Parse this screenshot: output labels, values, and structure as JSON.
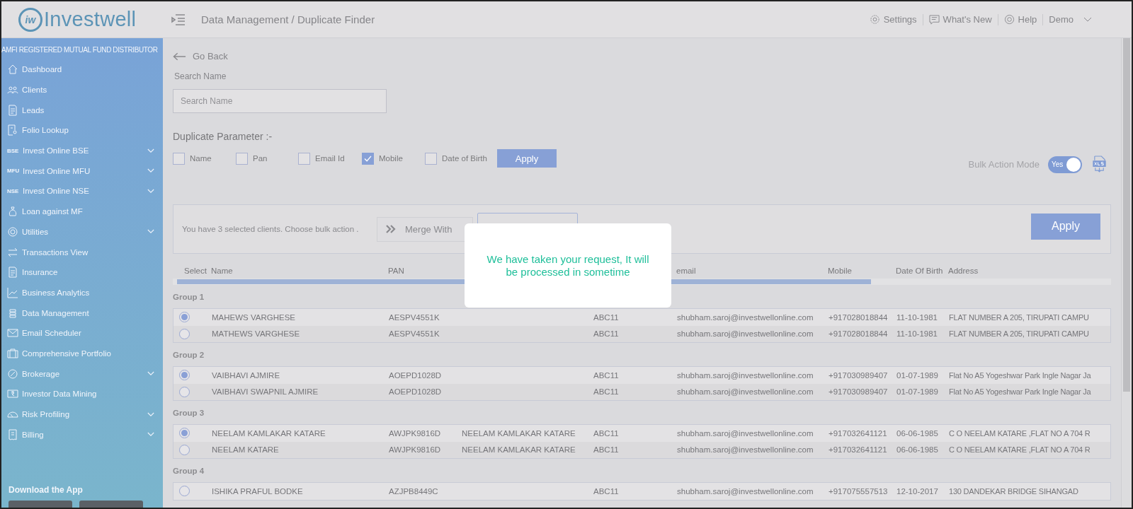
{
  "header": {
    "logo_mark": "iw",
    "logo": "Investwell",
    "breadcrumb": "Data Management / Duplicate Finder",
    "links": [
      {
        "label": "Settings"
      },
      {
        "label": "What's New"
      },
      {
        "label": "Help"
      }
    ],
    "user": "Demo"
  },
  "sidebar": {
    "tagline": "AMFI REGISTERED MUTUAL FUND DISTRIBUTOR",
    "items": [
      {
        "label": "Dashboard",
        "has_submenu": false
      },
      {
        "label": "Clients",
        "has_submenu": false
      },
      {
        "label": "Leads",
        "has_submenu": false
      },
      {
        "label": "Folio Lookup",
        "has_submenu": false
      },
      {
        "label": "Invest Online BSE",
        "prefix": "BSE",
        "has_submenu": true
      },
      {
        "label": "Invest Online MFU",
        "prefix": "MFU",
        "has_submenu": true
      },
      {
        "label": "Invest Online NSE",
        "prefix": "NSE",
        "has_submenu": true
      },
      {
        "label": "Loan against MF",
        "has_submenu": false
      },
      {
        "label": "Utilities",
        "has_submenu": true
      },
      {
        "label": "Transactions View",
        "has_submenu": false
      },
      {
        "label": "Insurance",
        "has_submenu": false
      },
      {
        "label": "Business Analytics",
        "has_submenu": false
      },
      {
        "label": "Data Management",
        "has_submenu": false
      },
      {
        "label": "Email Scheduler",
        "has_submenu": false
      },
      {
        "label": "Comprehensive Portfolio",
        "has_submenu": false
      },
      {
        "label": "Brokerage",
        "has_submenu": true
      },
      {
        "label": "Investor Data Mining",
        "has_submenu": false
      },
      {
        "label": "Risk Profiling",
        "has_submenu": true
      },
      {
        "label": "Billing",
        "has_submenu": true
      }
    ],
    "download_title": "Download the App"
  },
  "back": "Go Back",
  "search": {
    "label": "Search Name",
    "placeholder": "Search Name"
  },
  "duplicate_parameter": {
    "title": "Duplicate Parameter :-",
    "options": [
      {
        "label": "Name",
        "checked": false
      },
      {
        "label": "Pan",
        "checked": false
      },
      {
        "label": "Email Id",
        "checked": false
      },
      {
        "label": "Mobile",
        "checked": true
      },
      {
        "label": "Date of Birth",
        "checked": false
      }
    ],
    "apply": "Apply"
  },
  "bulk_mode": {
    "label": "Bulk Action Mode",
    "on": true,
    "text": "Yes"
  },
  "bulk_panel": {
    "message": "You have 3 selected clients. Choose bulk action .",
    "merge": "Merge With",
    "apply": "Apply"
  },
  "table": {
    "columns": [
      "Select",
      "Name",
      "PAN",
      "email",
      "Mobile",
      "Date Of Birth",
      "Address"
    ],
    "groups": [
      {
        "label": "Group 1",
        "rows": [
          {
            "selected": true,
            "name": "MAHEWS VARGHESE",
            "pan": "AESPV4551K",
            "column_5": "ABC11",
            "email": "shubham.saroj@investwellonline.com",
            "mobile": "+917028018844",
            "dob": "11-10-1981",
            "address": "FLAT NUMBER A 205, TIRUPATI CAMPU"
          },
          {
            "selected": false,
            "name": "MATHEWS VARGHESE",
            "pan": "AESPV4551K",
            "column_5": "ABC11",
            "email": "shubham.saroj@investwellonline.com",
            "mobile": "+917028018844",
            "dob": "11-10-1981",
            "address": "FLAT NUMBER A 205, TIRUPATI CAMPU"
          }
        ]
      },
      {
        "label": "Group 2",
        "rows": [
          {
            "selected": true,
            "name": "VAIBHAVI AJMIRE",
            "pan": "AOEPD1028D",
            "column_5": "ABC11",
            "email": "shubham.saroj@investwellonline.com",
            "mobile": "+917030989407",
            "dob": "01-07-1989",
            "address": "Flat No A5 Yogeshwar Park Ingle Nagar Ja"
          },
          {
            "selected": false,
            "name": "VAIBHAVI SWAPNIL AJMIRE",
            "pan": "AOEPD1028D",
            "column_5": "ABC11",
            "email": "shubham.saroj@investwellonline.com",
            "mobile": "+917030989407",
            "dob": "01-07-1989",
            "address": "Flat No A5 Yogeshwar Park Ingle Nagar Ja"
          }
        ]
      },
      {
        "label": "Group 3",
        "rows": [
          {
            "selected": true,
            "name": "NEELAM KAMLAKAR KATARE",
            "pan": "AWJPK9816D",
            "column_4": "NEELAM KAMLAKAR KATARE",
            "column_5": "ABC11",
            "email": "shubham.saroj@investwellonline.com",
            "mobile": "+917032641121",
            "dob": "06-06-1985",
            "address": "C O NEELAM KATARE ,FLAT NO A 704 R"
          },
          {
            "selected": false,
            "name": "NEELAM KATARE",
            "pan": "AWJPK9816D",
            "column_4": "NEELAM KAMLAKAR KATARE",
            "column_5": "ABC11",
            "email": "shubham.saroj@investwellonline.com",
            "mobile": "+917032641121",
            "dob": "06-06-1985",
            "address": "C O NEELAM KATARE ,FLAT NO A 704 R"
          }
        ]
      },
      {
        "label": "Group 4",
        "rows": [
          {
            "selected": false,
            "name": "ISHIKA PRAFUL BODKE",
            "pan": "AZJPB8449C",
            "column_5": "ABC11",
            "email": "shubham.saroj@investwellonline.com",
            "mobile": "+917075557513",
            "dob": "12-10-2017",
            "address": "130 DANDEKAR BRIDGE SIHANGAD"
          }
        ]
      }
    ]
  },
  "modal": {
    "message": "We have taken your request, It will be processed in sometime"
  }
}
